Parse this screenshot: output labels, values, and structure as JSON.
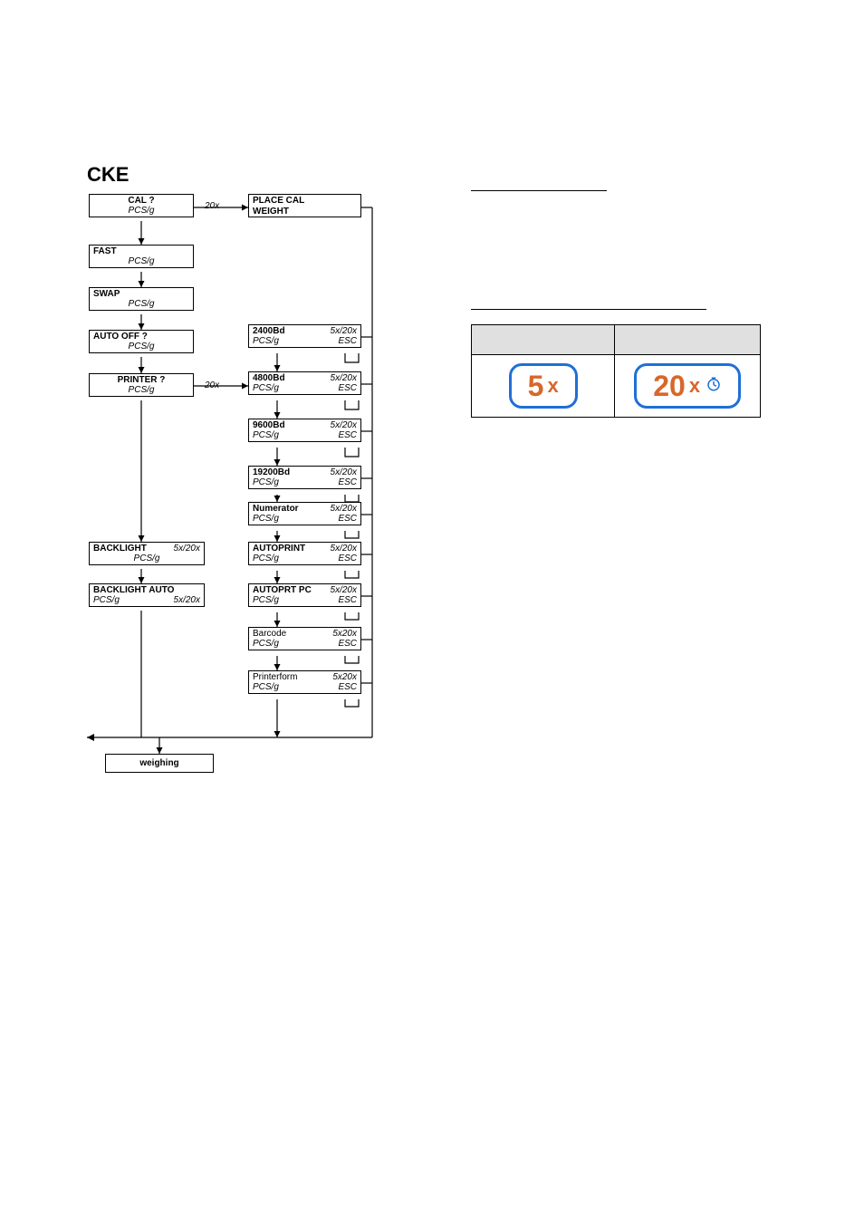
{
  "title": "CKE",
  "flow": {
    "cal": {
      "label": "CAL ?",
      "sub_left": "PCS/g"
    },
    "place": {
      "label1": "PLACE CAL",
      "label2": "WEIGHT"
    },
    "fast": {
      "label": "FAST",
      "sub_left": "PCS/g"
    },
    "swap": {
      "label": "SWAP",
      "sub_left": "PCS/g"
    },
    "autooff": {
      "label": "AUTO OFF ?",
      "sub_left": "PCS/g"
    },
    "printer": {
      "label": "PRINTER ?",
      "sub_left": "PCS/g"
    },
    "backlight": {
      "label": "BACKLIGHT",
      "right": "5x/20x",
      "sub_left": "PCS/g"
    },
    "backlightauto": {
      "label": "BACKLIGHT AUTO",
      "sub_left": "PCS/g",
      "sub_right": "5x/20x"
    },
    "baud2400": {
      "label": "2400Bd",
      "right": "5x/20x",
      "sub_left": "PCS/g",
      "sub_right": "ESC"
    },
    "baud4800": {
      "label": "4800Bd",
      "right": "5x/20x",
      "sub_left": "PCS/g",
      "sub_right": "ESC"
    },
    "baud9600": {
      "label": "9600Bd",
      "right": "5x/20x",
      "sub_left": "PCS/g",
      "sub_right": "ESC"
    },
    "baud19200": {
      "label": "19200Bd",
      "right": "5x/20x",
      "sub_left": "PCS/g",
      "sub_right": "ESC"
    },
    "numerator": {
      "label": "Numerator",
      "right": "5x/20x",
      "sub_left": "PCS/g",
      "sub_right": "ESC"
    },
    "autoprint": {
      "label": "AUTOPRINT",
      "right": "5x/20x",
      "sub_left": "PCS/g",
      "sub_right": "ESC"
    },
    "autoprtpc": {
      "label": "AUTOPRT PC",
      "right": "5x/20x",
      "sub_left": "PCS/g",
      "sub_right": "ESC"
    },
    "barcode": {
      "label": "Barcode",
      "right": "5x20x",
      "sub_left": "PCS/g",
      "sub_right": "ESC"
    },
    "printerform": {
      "label": "Printerform",
      "right": "5x20x",
      "sub_left": "PCS/g",
      "sub_right": "ESC"
    },
    "weighing": {
      "label": "weighing"
    }
  },
  "edge_20x_1": "20x",
  "edge_20x_2": "20x",
  "keys": {
    "five": {
      "num": "5",
      "x": "x"
    },
    "twenty": {
      "num": "20",
      "x": "x"
    }
  }
}
